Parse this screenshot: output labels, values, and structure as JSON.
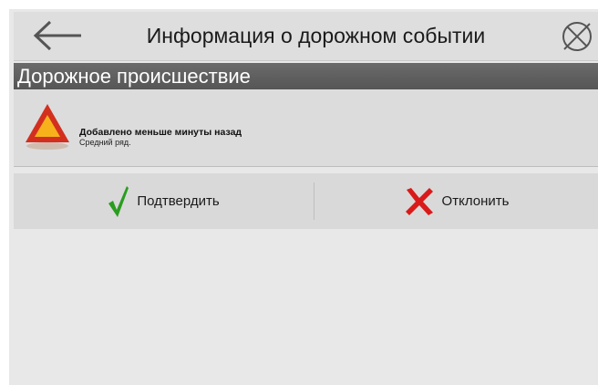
{
  "header": {
    "title": "Информация о дорожном событии",
    "back_icon": "arrow-left-icon",
    "close_icon": "crossed-circle-icon"
  },
  "section": {
    "title": "Дорожное происшествие"
  },
  "event": {
    "icon": "warning-triangle-icon",
    "title": "Добавлено меньше минуты назад",
    "subtitle": "Средний ряд."
  },
  "actions": {
    "confirm_label": "Подтвердить",
    "confirm_icon": "check-icon",
    "reject_label": "Отклонить",
    "reject_icon": "x-icon"
  },
  "colors": {
    "confirm": "#2a9d1f",
    "reject": "#d91a1a",
    "warning_red": "#d32f1f",
    "warning_yellow": "#f7b21b"
  }
}
